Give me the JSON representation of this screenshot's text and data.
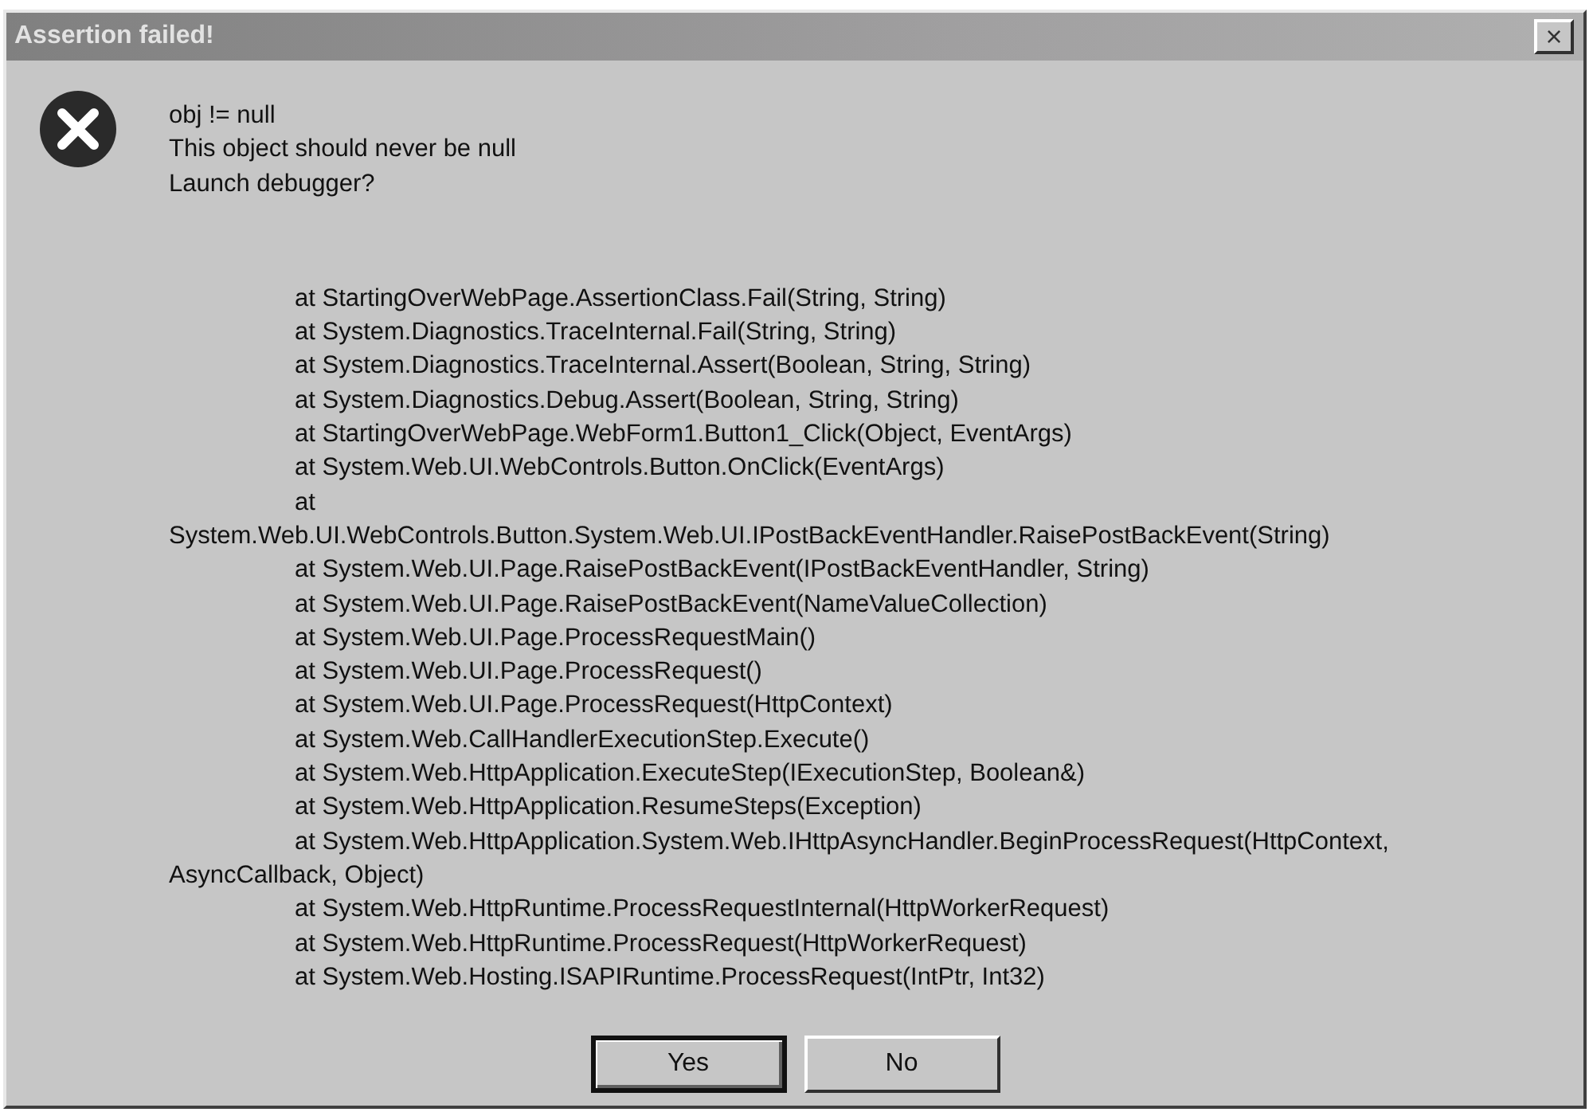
{
  "window": {
    "title": "Assertion failed!",
    "close": "×"
  },
  "message": [
    "obj != null",
    "This object should never be null",
    "Launch debugger?"
  ],
  "trace": [
    {
      "kind": "frame",
      "text": "at StartingOverWebPage.AssertionClass.Fail(String, String)"
    },
    {
      "kind": "frame",
      "text": "at System.Diagnostics.TraceInternal.Fail(String, String)"
    },
    {
      "kind": "frame",
      "text": "at System.Diagnostics.TraceInternal.Assert(Boolean, String, String)"
    },
    {
      "kind": "frame",
      "text": "at System.Diagnostics.Debug.Assert(Boolean, String, String)"
    },
    {
      "kind": "frame",
      "text": "at StartingOverWebPage.WebForm1.Button1_Click(Object, EventArgs)"
    },
    {
      "kind": "frame",
      "text": "at System.Web.UI.WebControls.Button.OnClick(EventArgs)"
    },
    {
      "kind": "frame",
      "text": "at"
    },
    {
      "kind": "wrap",
      "text": "System.Web.UI.WebControls.Button.System.Web.UI.IPostBackEventHandler.RaisePostBackEvent(String)"
    },
    {
      "kind": "frame",
      "text": "at System.Web.UI.Page.RaisePostBackEvent(IPostBackEventHandler, String)"
    },
    {
      "kind": "frame",
      "text": "at System.Web.UI.Page.RaisePostBackEvent(NameValueCollection)"
    },
    {
      "kind": "frame",
      "text": "at System.Web.UI.Page.ProcessRequestMain()"
    },
    {
      "kind": "frame",
      "text": "at System.Web.UI.Page.ProcessRequest()"
    },
    {
      "kind": "frame",
      "text": "at System.Web.UI.Page.ProcessRequest(HttpContext)"
    },
    {
      "kind": "frame",
      "text": "at System.Web.CallHandlerExecutionStep.Execute()"
    },
    {
      "kind": "frame",
      "text": "at System.Web.HttpApplication.ExecuteStep(IExecutionStep, Boolean&)"
    },
    {
      "kind": "frame",
      "text": "at System.Web.HttpApplication.ResumeSteps(Exception)"
    },
    {
      "kind": "frame",
      "text": "at System.Web.HttpApplication.System.Web.IHttpAsyncHandler.BeginProcessRequest(HttpContext,"
    },
    {
      "kind": "wrap",
      "text": "AsyncCallback, Object)"
    },
    {
      "kind": "frame",
      "text": "at System.Web.HttpRuntime.ProcessRequestInternal(HttpWorkerRequest)"
    },
    {
      "kind": "frame",
      "text": "at System.Web.HttpRuntime.ProcessRequest(HttpWorkerRequest)"
    },
    {
      "kind": "frame",
      "text": "at System.Web.Hosting.ISAPIRuntime.ProcessRequest(IntPtr, Int32)"
    }
  ],
  "buttons": [
    {
      "label": "Yes",
      "default": true
    },
    {
      "label": "No",
      "default": false
    }
  ]
}
